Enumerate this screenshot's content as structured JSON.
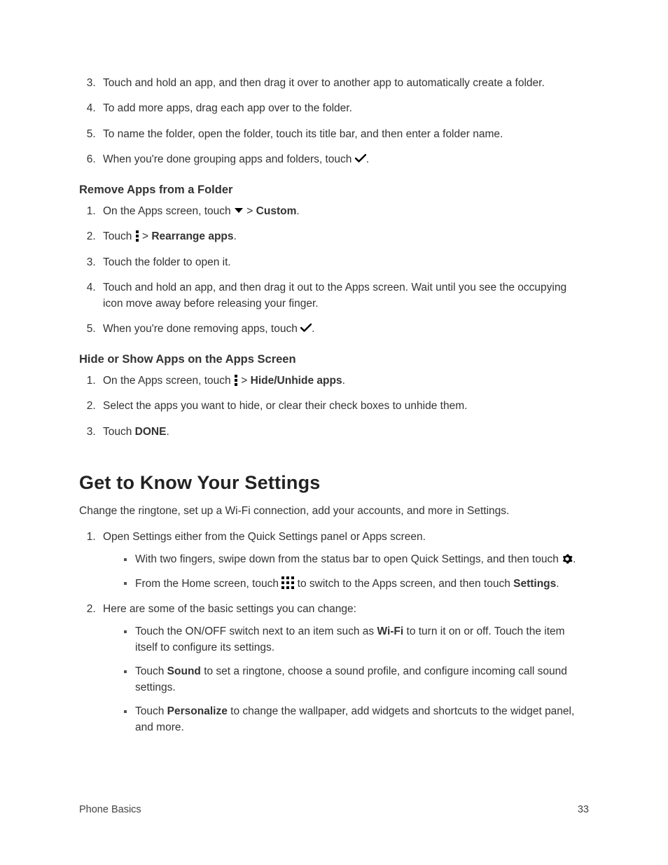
{
  "listA": {
    "start": 3,
    "items": [
      "Touch and hold an app, and then drag it over to another app to automatically create a folder.",
      "To add more apps, drag each app over to the folder.",
      "To name the folder, open the folder, touch its title bar, and then enter a folder name.",
      {
        "pre": "When you're done grouping apps and folders, touch ",
        "icon": "check",
        "post": "."
      }
    ]
  },
  "heading_remove": "Remove Apps from a Folder",
  "listB": {
    "start": 1,
    "items": [
      {
        "pre": "On the Apps screen, touch ",
        "icon": "dropdown",
        "mid": " > ",
        "bold": "Custom",
        "post": "."
      },
      {
        "pre": "Touch ",
        "icon": "overflow",
        "mid": " > ",
        "bold": "Rearrange apps",
        "post": "."
      },
      "Touch the folder to open it.",
      "Touch and hold an app, and then drag it out to the Apps screen. Wait until you see the occupying icon move away before releasing your finger.",
      {
        "pre": "When you're done removing apps, touch ",
        "icon": "check",
        "post": "."
      }
    ]
  },
  "heading_hide": "Hide or Show Apps on the Apps Screen",
  "listC": {
    "start": 1,
    "items": [
      {
        "pre": "On the Apps screen, touch ",
        "icon": "overflow",
        "mid": " > ",
        "bold": "Hide/Unhide apps",
        "post": "."
      },
      "Select the apps you want to hide, or clear their check boxes to unhide them.",
      {
        "pre": "Touch ",
        "bold": "DONE",
        "post": "."
      }
    ]
  },
  "section_settings": "Get to Know Your Settings",
  "settings_intro": "Change the ringtone, set up a Wi-Fi connection, add your accounts, and more in Settings.",
  "listD": {
    "start": 1,
    "items": [
      {
        "text": "Open Settings either from the Quick Settings panel or Apps screen.",
        "bullets": [
          {
            "pre": "With two fingers, swipe down from the status bar to open Quick Settings, and then touch ",
            "icon": "gear",
            "post": "."
          },
          {
            "pre": "From the Home screen, touch ",
            "icon": "apps",
            "mid": " to switch to the Apps screen, and then touch ",
            "bold": "Settings",
            "post": "."
          }
        ]
      },
      {
        "text": "Here are some of the basic settings you can change:",
        "bullets": [
          {
            "pre": "Touch the ON/OFF switch next to an item such as ",
            "bold": "Wi-Fi",
            "post": " to turn it on or off. Touch the item itself to configure its settings."
          },
          {
            "pre": "Touch ",
            "bold": "Sound",
            "post": " to set a ringtone, choose a sound profile, and configure incoming call sound settings."
          },
          {
            "pre": "Touch ",
            "bold": "Personalize",
            "post": " to change the wallpaper, add widgets and shortcuts to the widget panel, and more."
          }
        ]
      }
    ]
  },
  "footer": {
    "left": "Phone Basics",
    "right": "33"
  }
}
